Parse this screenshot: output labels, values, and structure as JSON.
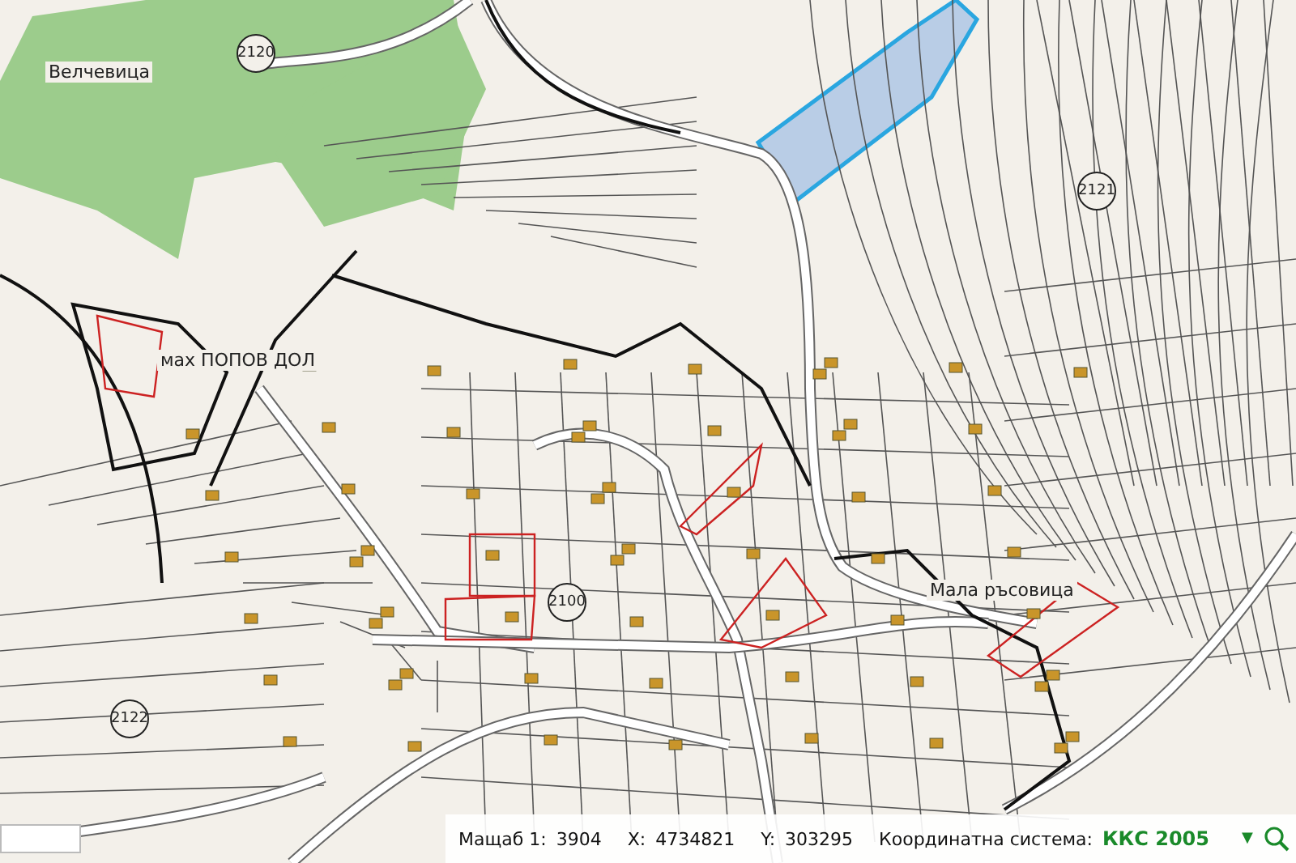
{
  "map": {
    "labels": [
      {
        "kind": "place",
        "text": "Велчевица"
      },
      {
        "kind": "parcel",
        "text": "2120"
      },
      {
        "kind": "parcel",
        "text": "2121"
      },
      {
        "kind": "place",
        "text": "мах ПОПОВ ДОЛ"
      },
      {
        "kind": "parcel",
        "text": "2100"
      },
      {
        "kind": "place",
        "text": "Мала ръсовица"
      },
      {
        "kind": "parcel",
        "text": "2122"
      }
    ]
  },
  "status_bar": {
    "scale_label": "Мащаб 1:",
    "scale_value": "3904",
    "x_label": "X:",
    "x_value": "4734821",
    "y_label": "Y:",
    "y_value": "303295",
    "crs_label": "Координатна система:",
    "crs_value": "ККС 2005",
    "crs_caret": "▼"
  }
}
